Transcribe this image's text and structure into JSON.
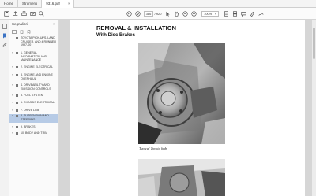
{
  "tabs": [
    {
      "label": "Home"
    },
    {
      "label": "Strumenti"
    },
    {
      "label": "9316.pdf"
    }
  ],
  "toolbar": {
    "page_current": "386",
    "page_total": "/ 920",
    "zoom": "100%"
  },
  "panel": {
    "title": "Segnalibri",
    "close": "×"
  },
  "bookmarks": [
    {
      "label": "TOYOTA PICK-UPS, LAND CRUISER, AND 4 RUNNER 1997-00",
      "arrow": ""
    },
    {
      "label": "1. GENERAL INFORMATION AND MAINTENANCE",
      "arrow": "›"
    },
    {
      "label": "2. ENGINE ELECTRICAL",
      "arrow": "›"
    },
    {
      "label": "3. ENGINE AND ENGINE OVERHAUL",
      "arrow": "›"
    },
    {
      "label": "4. DRIVEABILITY AND EMISSION CONTROLS",
      "arrow": "›"
    },
    {
      "label": "5. FUEL SYSTEM",
      "arrow": "›"
    },
    {
      "label": "6. CHASSIS ELECTRICAL",
      "arrow": "›"
    },
    {
      "label": "7. DRIVE LINE",
      "arrow": "›"
    },
    {
      "label": "8. SUSPENSION AND STEERING",
      "arrow": "›",
      "selected": true
    },
    {
      "label": "9. BRAKES",
      "arrow": "›"
    },
    {
      "label": "10. BODY AND TRIM",
      "arrow": "›"
    }
  ],
  "document": {
    "heading": "REMOVAL & INSTALLATION",
    "subheading": "With Disc Brakes",
    "caption": "Typical Toyota hub"
  }
}
